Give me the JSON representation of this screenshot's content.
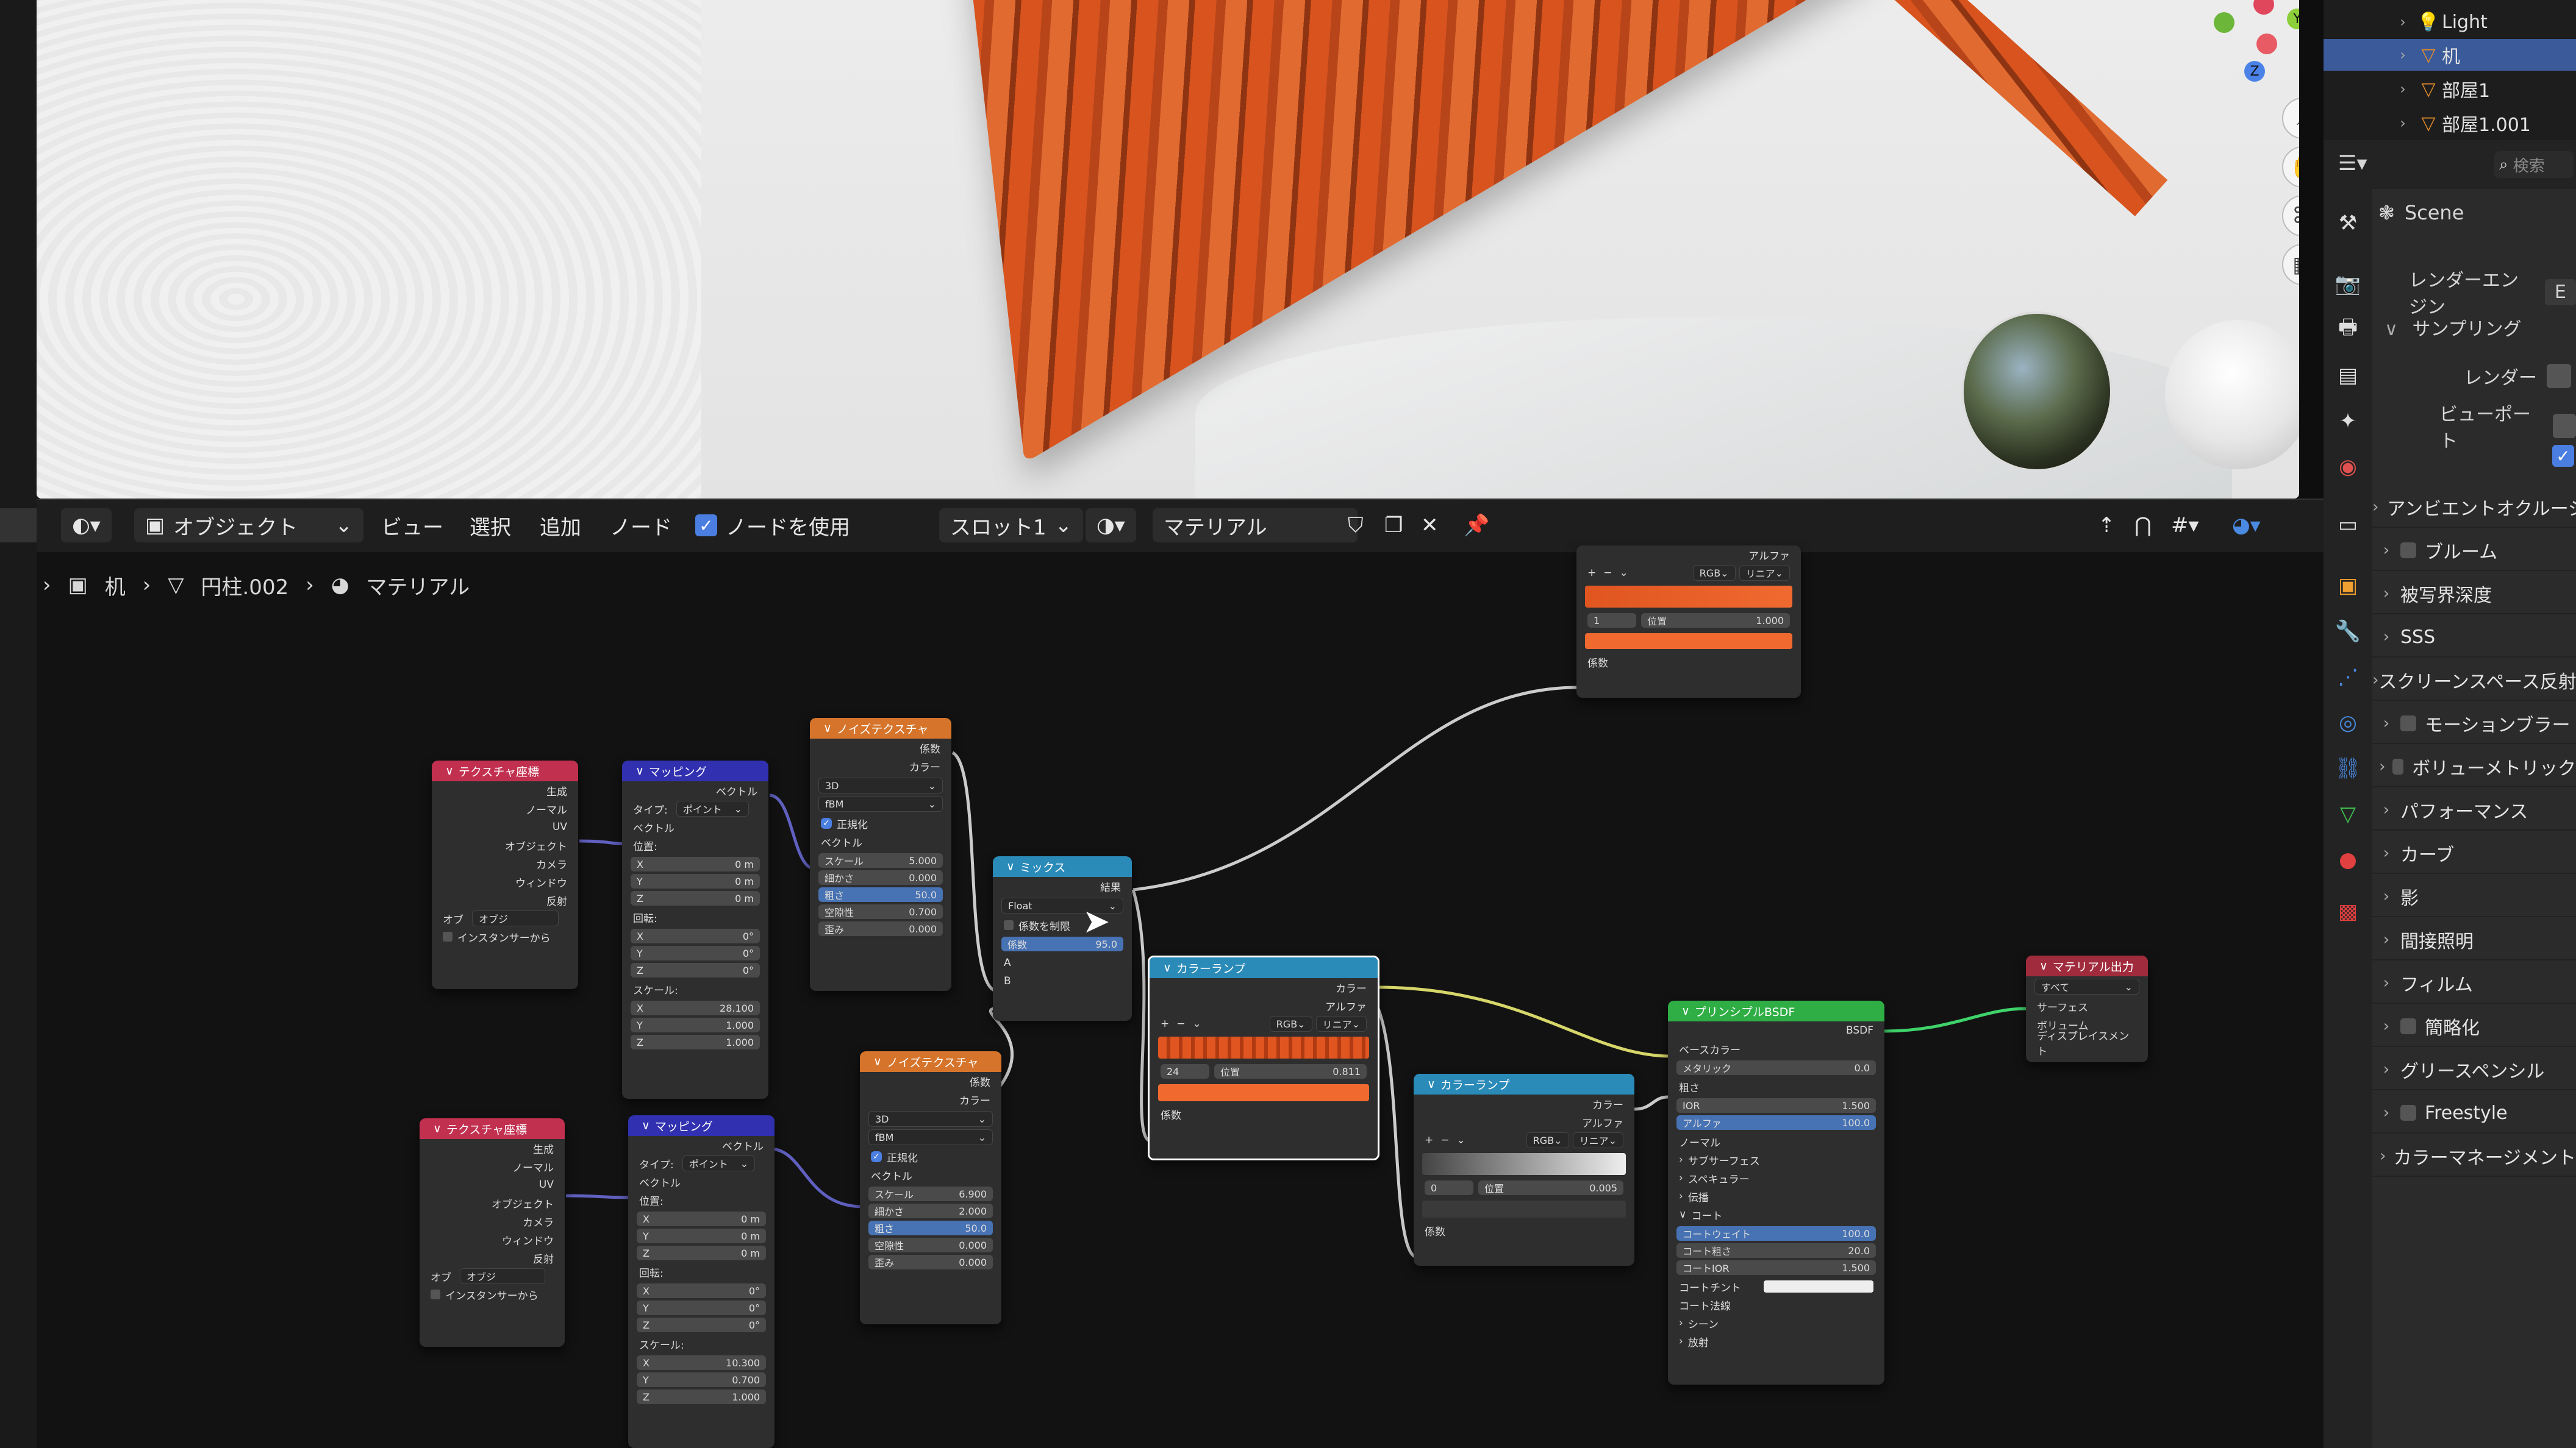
{
  "outliner": {
    "items": [
      {
        "label": "Light",
        "icon": "light-bulb-icon",
        "selected": false
      },
      {
        "label": "机",
        "icon": "mesh-triangle-icon",
        "selected": true
      },
      {
        "label": "部屋1",
        "icon": "mesh-triangle-icon",
        "selected": false
      },
      {
        "label": "部屋1.001",
        "icon": "mesh-triangle-icon",
        "selected": false
      }
    ],
    "search_placeholder": "検索"
  },
  "properties": {
    "scene_label": "Scene",
    "render_engine_label": "レンダーエンジン",
    "render_engine_value": "E",
    "sampling_label": "サンプリング",
    "render_label": "レンダー",
    "viewport_label": "ビューポート",
    "panels": [
      "アンビエントオクルージョン",
      "ブルーム",
      "被写界深度",
      "SSS",
      "スクリーンスペース反射",
      "モーションブラー",
      "ボリューメトリック",
      "パフォーマンス",
      "カーブ",
      "影",
      "間接照明",
      "フィルム",
      "簡略化",
      "グリースペンシル",
      "Freestyle",
      "カラーマネージメント"
    ]
  },
  "node_editor_header": {
    "mode": "オブジェクト",
    "view": "ビュー",
    "select": "選択",
    "add": "追加",
    "node": "ノード",
    "use_nodes": "ノードを使用",
    "slot": "スロット1",
    "material": "マテリアル"
  },
  "breadcrumb": [
    "机",
    "円柱.002",
    "マテリアル"
  ],
  "nodes": {
    "texcoord1": {
      "title": "テクスチャ座標",
      "outputs": [
        "生成",
        "ノーマル",
        "UV",
        "オブジェクト",
        "カメラ",
        "ウィンドウ",
        "反射"
      ],
      "object_label": "オブ",
      "object_placeholder": "オブジ",
      "instancer": "インスタンサーから"
    },
    "mapping1": {
      "title": "マッピング",
      "vector_out": "ベクトル",
      "type_label": "タイプ:",
      "type_value": "ポイント",
      "vector_in": "ベクトル",
      "location": "位置:",
      "loc": [
        "0 m",
        "0 m",
        "0 m"
      ],
      "rotation": "回転:",
      "rot": [
        "0°",
        "0°",
        "0°"
      ],
      "scale": "スケール:",
      "scl": [
        "28.100",
        "1.000",
        "1.000"
      ]
    },
    "noise1": {
      "title": "ノイズテクスチャ",
      "out_fac": "係数",
      "out_color": "カラー",
      "dim": "3D",
      "type": "fBM",
      "normalize": "正規化",
      "vector": "ベクトル",
      "scale": [
        "スケール",
        "5.000"
      ],
      "detail": [
        "細かさ",
        "0.000"
      ],
      "roughness": [
        "粗さ",
        "50.0"
      ],
      "lacunarity": [
        "空隙性",
        "0.700"
      ],
      "distortion": [
        "歪み",
        "0.000"
      ]
    },
    "mix": {
      "title": "ミックス",
      "out": "結果",
      "type": "Float",
      "clamp": "係数を制限",
      "fac_label": "係数",
      "fac_value": "95.0",
      "in_a": "A",
      "in_b": "B"
    },
    "texcoord2": {
      "title": "テクスチャ座標",
      "outputs": [
        "生成",
        "ノーマル",
        "UV",
        "オブジェクト",
        "カメラ",
        "ウィンドウ",
        "反射"
      ],
      "object_label": "オブ",
      "object_placeholder": "オブジ",
      "instancer": "インスタンサーから"
    },
    "mapping2": {
      "title": "マッピング",
      "vector_out": "ベクトル",
      "type_label": "タイプ:",
      "type_value": "ポイント",
      "vector_in": "ベクトル",
      "location": "位置:",
      "loc": [
        "0 m",
        "0 m",
        "0 m"
      ],
      "rotation": "回転:",
      "rot": [
        "0°",
        "0°",
        "0°"
      ],
      "scale": "スケール:",
      "scl": [
        "10.300",
        "0.700",
        "1.000"
      ]
    },
    "noise2": {
      "title": "ノイズテクスチャ",
      "out_fac": "係数",
      "out_color": "カラー",
      "dim": "3D",
      "type": "fBM",
      "normalize": "正規化",
      "vector": "ベクトル",
      "scale": [
        "スケール",
        "6.900"
      ],
      "detail": [
        "細かさ",
        "2.000"
      ],
      "roughness": [
        "粗さ",
        "50.0"
      ],
      "lacunarity": [
        "空隙性",
        "0.000"
      ],
      "distortion": [
        "歪み",
        "0.000"
      ]
    },
    "ramp_top": {
      "out_alpha": "アルファ",
      "mode": "RGB",
      "interp": "リニア",
      "index": "1",
      "pos_label": "位置",
      "pos_value": "1.000",
      "in_fac": "係数"
    },
    "ramp1": {
      "title": "カラーランプ",
      "out_color": "カラー",
      "out_alpha": "アルファ",
      "mode": "RGB",
      "interp": "リニア",
      "index": "24",
      "pos_label": "位置",
      "pos_value": "0.811",
      "in_fac": "係数"
    },
    "ramp2": {
      "title": "カラーランプ",
      "out_color": "カラー",
      "out_alpha": "アルファ",
      "mode": "RGB",
      "interp": "リニア",
      "index": "0",
      "pos_label": "位置",
      "pos_value": "0.005",
      "in_fac": "係数"
    },
    "bsdf": {
      "title": "プリンシプルBSDF",
      "out": "BSDF",
      "base_color": "ベースカラー",
      "metallic": [
        "メタリック",
        "0.0"
      ],
      "roughness": "粗さ",
      "ior": [
        "IOR",
        "1.500"
      ],
      "alpha": [
        "アルファ",
        "100.0"
      ],
      "normal": "ノーマル",
      "subsurface": "サブサーフェス",
      "specular": "スペキュラー",
      "transmission": "伝播",
      "coat": "コート",
      "coat_weight": [
        "コートウェイト",
        "100.0"
      ],
      "coat_rough": [
        "コート粗さ",
        "20.0"
      ],
      "coat_ior": [
        "コートIOR",
        "1.500"
      ],
      "coat_tint": "コートチント",
      "coat_normal": "コート法線",
      "sheen": "シーン",
      "emission": "放射"
    },
    "output": {
      "title": "マテリアル出力",
      "target": "すべて",
      "surface": "サーフェス",
      "volume": "ボリューム",
      "displacement": "ディスプレイスメント"
    }
  },
  "colors": {
    "accent": "#4772b3",
    "selected": "#3a5a9a",
    "texcoord_head": "#c23050",
    "mapping_head": "#3030b0",
    "noise_head": "#d5742a",
    "converter_head": "#2a8ab8",
    "shader_head": "#2fae45",
    "output_head": "#a02b3c"
  }
}
